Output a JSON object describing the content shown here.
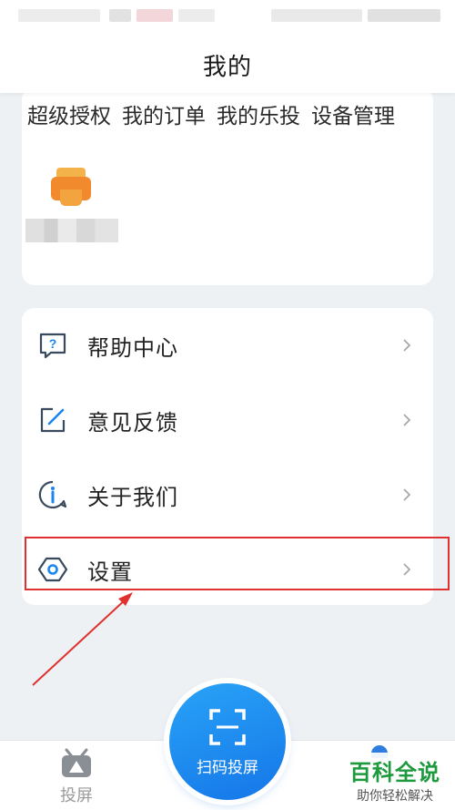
{
  "header": {
    "title": "我的"
  },
  "quick_tabs": [
    "超级授权",
    "我的订单",
    "我的乐投",
    "设备管理"
  ],
  "menu": {
    "items": [
      {
        "label": "帮助中心",
        "icon": "help-icon"
      },
      {
        "label": "意见反馈",
        "icon": "feedback-edit-icon"
      },
      {
        "label": "关于我们",
        "icon": "info-icon"
      },
      {
        "label": "设置",
        "icon": "settings-icon"
      }
    ]
  },
  "bottom_nav": {
    "cast_label": "投屏",
    "scan_label": "扫码投屏"
  },
  "watermark": {
    "title": "百科全说",
    "subtitle": "助你轻松解决"
  },
  "colors": {
    "accent_blue": "#1a86ee",
    "highlight_red": "#e0302f",
    "background": "#eef1f4"
  }
}
